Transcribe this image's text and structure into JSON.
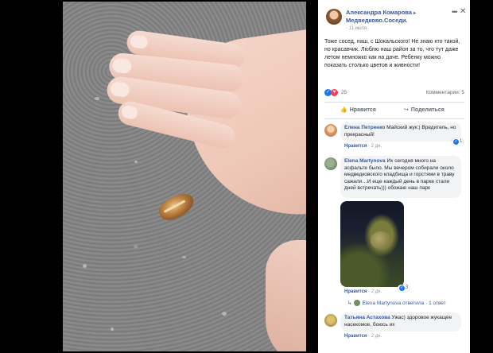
{
  "post": {
    "author": "Александра Комарова",
    "arrow": "▸",
    "group": "Медведково.Соседи.",
    "date": "· 11 июля ·",
    "text": "Тоже сосед, наш, с Шокальского! Не знаю кто такой, но красавчик. Люблю наш район за то, что тут даже летом немножко как на даче. Ребенку можно показать столько цветов и живности!",
    "reaction_count": "25",
    "comments_count": "Комментарии: 5",
    "like_label": "Нравится",
    "share_label": "Поделиться"
  },
  "icons": {
    "more": "•••",
    "close": "✕",
    "like": "👍",
    "share": "↪",
    "reply_arrow": "↳"
  },
  "comments": [
    {
      "name": "Елена Петренко",
      "text": " Майский жук:) Вредитель, но прекрасный!",
      "like_label": "Нравится",
      "age": "2 дн.",
      "reactions": "1",
      "avatar_color": "#e3b08c"
    },
    {
      "name": "Elena Martynova",
      "text": " Их сегодня много на асфальте было. Мы вечером собирали около медведковского кладбища и горстями в траву сажали…И еще каждый день в парке стали дней встречать))) обожаю наш парк",
      "like_label": "Нравится",
      "age": "2 дн.",
      "reactions": "3",
      "avatar_color": "#6e8f6a"
    },
    {
      "name": "Татьяна Астахова",
      "text": " Ужас) здоровое жукащее насекомое, боюсь их",
      "like_label": "Нравится",
      "age": "2 дн.",
      "avatar_color": "#8a7a3a"
    }
  ],
  "replies_summary": {
    "author": "Elena Martynova",
    "action": "ответила",
    "count": "· 1 ответ"
  },
  "colors": {
    "fb_blue": "#385898",
    "like_blue": "#1877f2",
    "bubble_bg": "#f2f3f5"
  }
}
